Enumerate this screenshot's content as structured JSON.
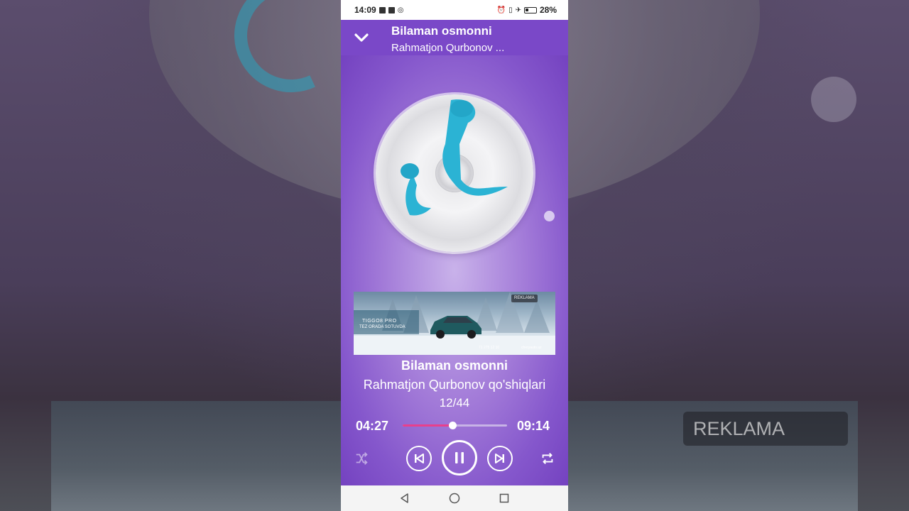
{
  "status_bar": {
    "time": "14:09",
    "battery": "28%"
  },
  "header": {
    "title": "Bilaman osmonni",
    "subtitle": "Rahmatjon Qurbonov ..."
  },
  "ad": {
    "label": "REKLAMA",
    "brand": "TIGGO8 PRO",
    "tagline": "TEZ ORADA SOTUVDA",
    "phone": "71 275 12 10",
    "site": "cheryauto.uz"
  },
  "track": {
    "title": "Bilaman osmonni",
    "artist": "Rahmatjon Qurbonov qo'shiqlari",
    "index": "12/44"
  },
  "playback": {
    "elapsed": "04:27",
    "total": "09:14",
    "progress": 0.477,
    "state": "playing"
  },
  "background": {
    "ad_label": "REKLAMA"
  },
  "colors": {
    "header": "#7a48c8",
    "progress": "#e8408c",
    "note_accent": "#2bb3d4"
  },
  "icons": {
    "collapse": "chevron-down-icon",
    "shuffle": "shuffle-icon",
    "previous": "skip-previous-icon",
    "pause": "pause-icon",
    "next": "skip-next-icon",
    "repeat": "repeat-icon",
    "back": "nav-back-icon",
    "home": "nav-home-icon",
    "recents": "nav-recents-icon"
  }
}
